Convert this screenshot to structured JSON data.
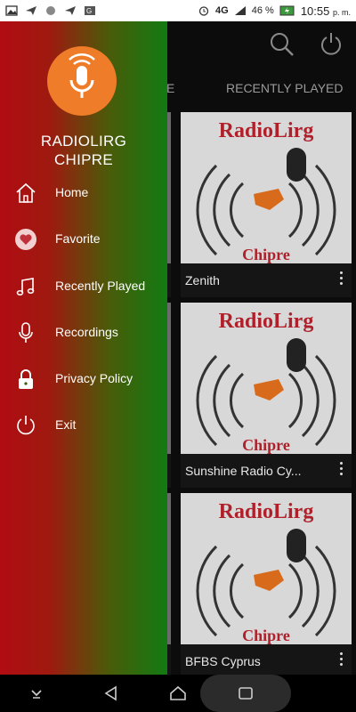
{
  "status_bar": {
    "signal": "4G",
    "battery": "46 %",
    "time": "10:55",
    "ampm": "p. m."
  },
  "tabs": {
    "left_fragment": "E",
    "recently_played": "RECENTLY PLAYED"
  },
  "drawer": {
    "app_name_line1": "RADIOLIRG",
    "app_name_line2": "CHIPRE",
    "menu": [
      {
        "label": "Home",
        "icon": "home-icon"
      },
      {
        "label": "Favorite",
        "icon": "heart-icon"
      },
      {
        "label": "Recently Played",
        "icon": "music-note-icon"
      },
      {
        "label": "Recordings",
        "icon": "microphone-icon"
      },
      {
        "label": "Privacy Policy",
        "icon": "lock-icon"
      },
      {
        "label": "Exit",
        "icon": "power-icon"
      }
    ]
  },
  "stations": [
    {
      "name": "Zenith"
    },
    {
      "name": "Sunshine Radio Cy..."
    },
    {
      "name": "BFBS Cyprus"
    }
  ],
  "card_art": {
    "brand": "RadioLirg",
    "subtitle": "Chipre"
  },
  "colors": {
    "logo": "#ee7c28",
    "drawer_start": "#b10c12",
    "drawer_end": "#117b12",
    "art_red": "#b0202a"
  }
}
